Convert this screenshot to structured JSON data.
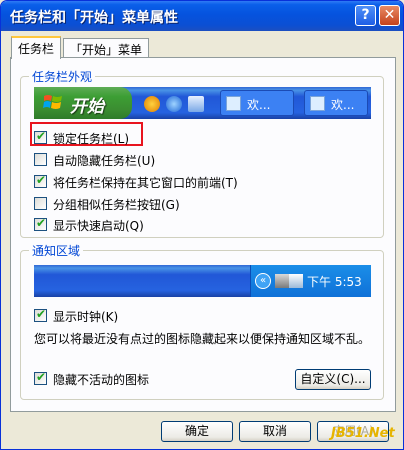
{
  "window": {
    "title": "任务栏和「开始」菜单属性",
    "help": "?",
    "close": "✕"
  },
  "tabs": [
    {
      "label": "任务栏"
    },
    {
      "label": "「开始」菜单"
    }
  ],
  "taskbar_group": {
    "title": "任务栏外观",
    "preview": {
      "start_label": "开始",
      "task1": "欢...",
      "task2": "欢..."
    },
    "options": [
      {
        "label": "锁定任务栏(L)",
        "checked": true
      },
      {
        "label": "自动隐藏任务栏(U)",
        "checked": false
      },
      {
        "label": "将任务栏保持在其它窗口的前端(T)",
        "checked": true
      },
      {
        "label": "分组相似任务栏按钮(G)",
        "checked": false
      },
      {
        "label": "显示快速启动(Q)",
        "checked": true
      }
    ]
  },
  "notify_group": {
    "title": "通知区域",
    "preview": {
      "chevron": "«",
      "clock": "下午 5:53"
    },
    "show_clock": {
      "label": "显示时钟(K)",
      "checked": true
    },
    "description": "您可以将最近没有点过的图标隐藏起来以便保持通知区域不乱。",
    "hide_inactive": {
      "label": "隐藏不活动的图标",
      "checked": true
    },
    "customize_label": "自定义(C)..."
  },
  "buttons": {
    "ok": "确定",
    "cancel": "取消",
    "apply": "应用(A)"
  },
  "watermark": "JB51.Net",
  "tick": "✔"
}
